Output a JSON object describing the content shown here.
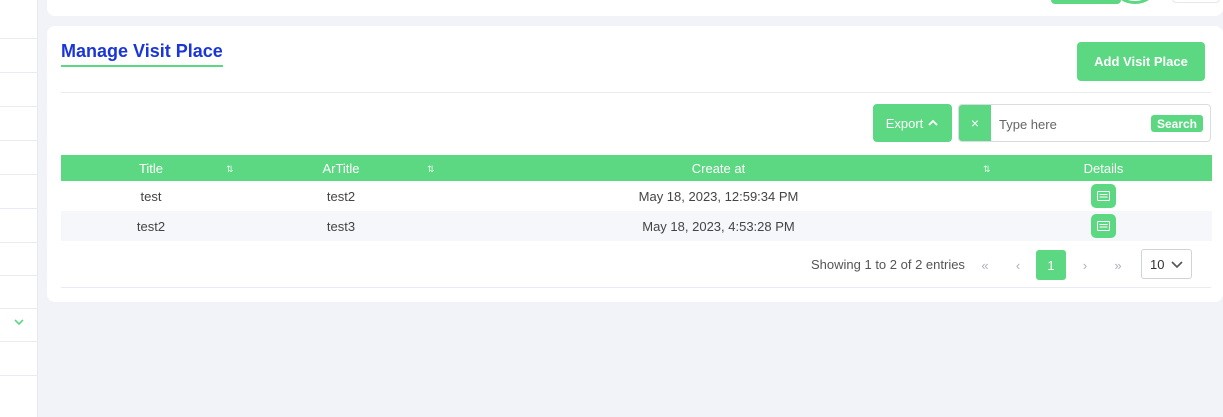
{
  "page": {
    "title": "Manage Visit Place",
    "add_button": "Add Visit Place"
  },
  "toolbar": {
    "export_label": "Export",
    "search_placeholder": "Type here",
    "search_button": "Search",
    "clear_symbol": "×"
  },
  "table": {
    "columns": [
      "Title",
      "ArTitle",
      "Create at",
      "Details"
    ],
    "rows": [
      {
        "title": "test",
        "artitle": "test2",
        "created": "May 18, 2023, 12:59:34 PM"
      },
      {
        "title": "test2",
        "artitle": "test3",
        "created": "May 18, 2023, 4:53:28 PM"
      }
    ]
  },
  "pagination": {
    "info": "Showing 1 to 2 of 2 entries",
    "first": "«",
    "prev": "‹",
    "current_page": "1",
    "next": "›",
    "last": "»",
    "page_size": "10"
  },
  "icons": {
    "sort": "sort-icon",
    "detail": "details-icon",
    "export_chevron": "chevron-up-icon",
    "page_size_chevron": "chevron-down-icon",
    "sidebar_chevron": "chevron-down-icon"
  },
  "colors": {
    "accent": "#5cd882",
    "title": "#1a35d8",
    "background": "#f1f3f8"
  }
}
